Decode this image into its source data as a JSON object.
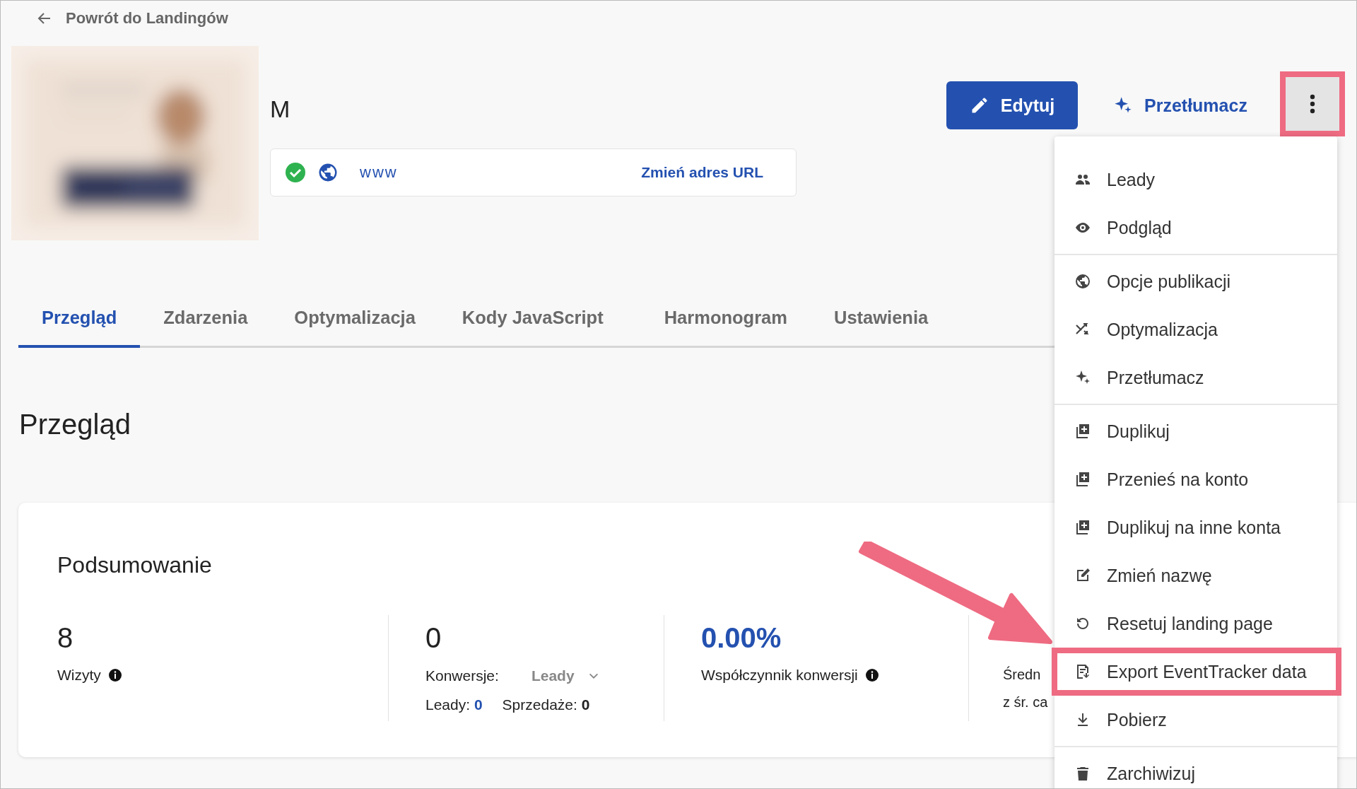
{
  "back_link": {
    "label": "Powrót do Landingów"
  },
  "header": {
    "title": "M",
    "url": {
      "verified": true,
      "address": "www",
      "change_link": "Zmień adres URL"
    }
  },
  "actions": {
    "edit": "Edytuj",
    "translate": "Przetłumacz",
    "more": {
      "highlighted": true
    }
  },
  "tabs": [
    {
      "label": "Przegląd",
      "selected": true
    },
    {
      "label": "Zdarzenia",
      "selected": false
    },
    {
      "label": "Optymalizacja",
      "selected": false
    },
    {
      "label": "Kody JavaScript",
      "selected": false
    },
    {
      "label": "Harmonogram",
      "selected": false
    },
    {
      "label": "Ustawienia",
      "selected": false
    }
  ],
  "section_title": "Przegląd",
  "summary": {
    "title": "Podsumowanie",
    "stats": [
      {
        "kind": "plain",
        "value": "8",
        "label": "Wizyty",
        "info": true
      },
      {
        "kind": "conversions",
        "value": "0",
        "label": "Konwersje:",
        "select": "Leady",
        "leads_label": "Leady:",
        "leads": "0",
        "sales_label": "Sprzedaże:",
        "sales": "0"
      },
      {
        "kind": "rate",
        "value": "0.00%",
        "label": "Współczynnik konwersji",
        "info": true
      },
      {
        "kind": "partial",
        "label": "Średn",
        "sub": "z śr. ca"
      }
    ]
  },
  "menu": {
    "groups": [
      {
        "items": [
          {
            "kind": "people",
            "label": "Leady",
            "highlighted": false
          },
          {
            "kind": "eye",
            "label": "Podgląd",
            "highlighted": false
          }
        ]
      },
      {
        "items": [
          {
            "kind": "globe",
            "label": "Opcje publikacji",
            "highlighted": false
          },
          {
            "kind": "shuffle",
            "label": "Optymalizacja",
            "highlighted": false
          },
          {
            "kind": "sparkle",
            "label": "Przetłumacz",
            "highlighted": false
          }
        ]
      },
      {
        "items": [
          {
            "kind": "copy",
            "label": "Duplikuj",
            "highlighted": false
          },
          {
            "kind": "copy",
            "label": "Przenieś na konto",
            "highlighted": false
          },
          {
            "kind": "copy",
            "label": "Duplikuj na inne konta",
            "highlighted": false
          },
          {
            "kind": "rename",
            "label": "Zmień nazwę",
            "highlighted": false
          },
          {
            "kind": "reset",
            "label": "Resetuj landing page",
            "highlighted": false
          },
          {
            "kind": "export",
            "label": "Export EventTracker data",
            "highlighted": true
          },
          {
            "kind": "download",
            "label": "Pobierz",
            "highlighted": false
          }
        ]
      },
      {
        "items": [
          {
            "kind": "trash",
            "label": "Zarchiwizuj",
            "highlighted": false
          }
        ]
      }
    ]
  },
  "annotation": {
    "arrow": true
  }
}
